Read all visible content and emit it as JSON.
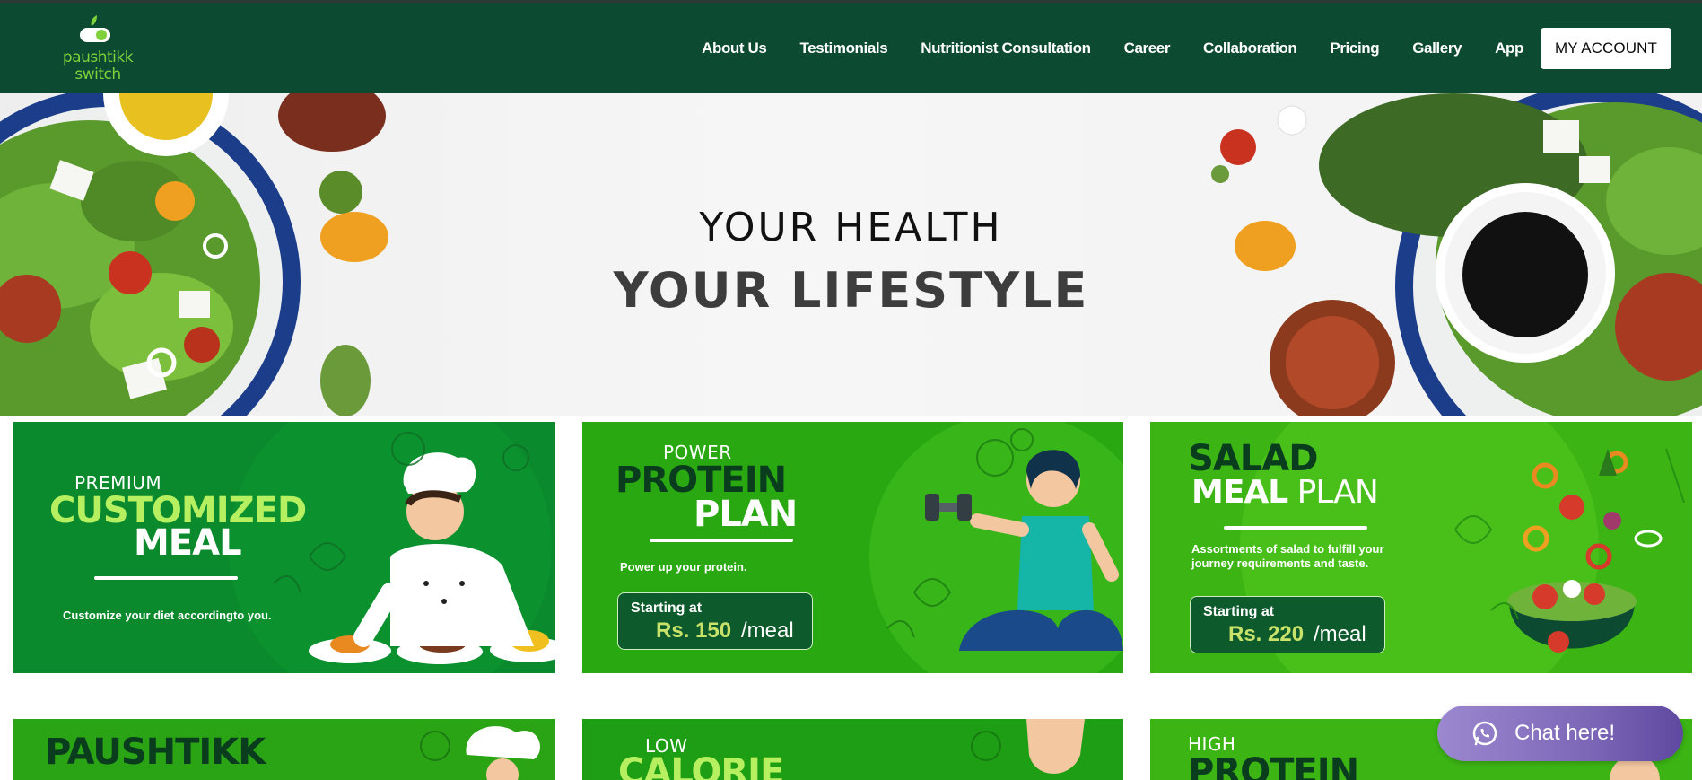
{
  "brand": {
    "logo_line1": "paushtikk",
    "logo_line2": "switch"
  },
  "nav": {
    "items": [
      "About Us",
      "Testimonials",
      "Nutritionist Consultation",
      "Career",
      "Collaboration",
      "Pricing",
      "Gallery",
      "App"
    ],
    "account_label": "MY ACCOUNT"
  },
  "hero": {
    "line1": "YOUR HEALTH",
    "line2": "YOUR LIFESTYLE"
  },
  "cards": [
    {
      "small": "PREMIUM",
      "big1": "CUSTOMIZED",
      "big2": "MEAL",
      "desc": "Customize your diet accordingto you."
    },
    {
      "small": "POWER",
      "big1": "PROTEIN",
      "big2": "PLAN",
      "desc": "Power up your protein.",
      "price_label": "Starting at",
      "price": "Rs. 150",
      "unit": "/meal"
    },
    {
      "big1": "SALAD",
      "big2a": "MEAL",
      "big2b": " PLAN",
      "desc1": "Assortments of salad to fulfill your",
      "desc2": "journey requirements and taste.",
      "price_label": "Starting at",
      "price": "Rs. 220",
      "unit": "/meal"
    }
  ],
  "bottom_cards": [
    {
      "big1": "PAUSHTIKK"
    },
    {
      "small": "LOW",
      "big1": "CALORIE"
    },
    {
      "small": "HIGH",
      "big1": "PROTEIN"
    }
  ],
  "chat": {
    "label": "Chat here!"
  },
  "colors": {
    "header": "#0c4a32",
    "card_dark": "#0b8a2c",
    "card_bright": "#3bb414",
    "accent_lime": "#b6f060",
    "price": "#c9e36a",
    "chat": "#8a76c4"
  }
}
